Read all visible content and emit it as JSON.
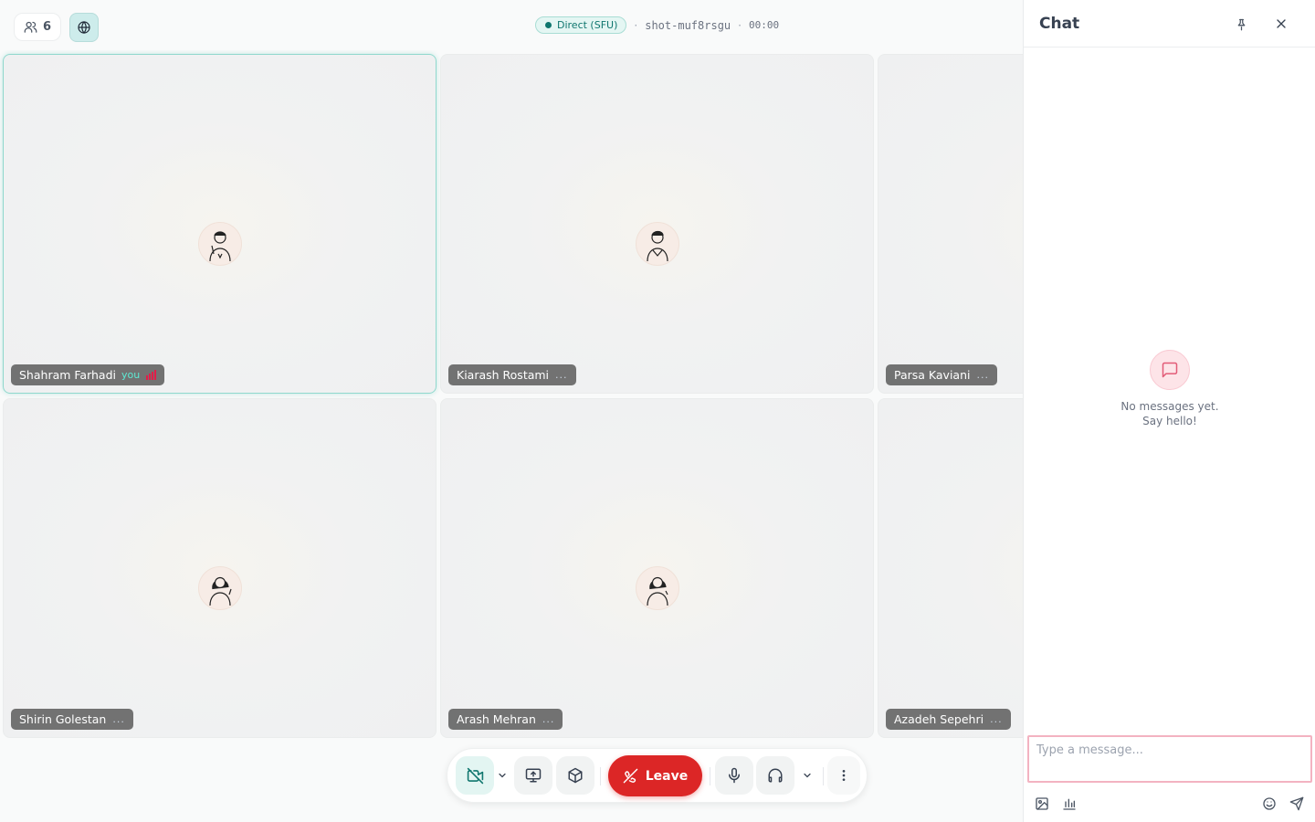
{
  "topbar": {
    "participant_count": "6",
    "connection_label": "Direct (SFU)",
    "separator": "·",
    "room_id": "shot-muf8rsgu",
    "timer": "00:00"
  },
  "tiles": [
    {
      "name": "Shahram Farhadi",
      "you_label": "you",
      "active": true
    },
    {
      "name": "Kiarash Rostami"
    },
    {
      "name": "Parsa Kaviani"
    },
    {
      "name": "Shirin Golestan"
    },
    {
      "name": "Arash Mehran"
    },
    {
      "name": "Azadeh Sepehri"
    }
  ],
  "status_dots": "...",
  "controls": {
    "leave_label": "Leave"
  },
  "chat": {
    "title": "Chat",
    "empty_line1": "No messages yet.",
    "empty_line2": "Say hello!",
    "input_placeholder": "Type a message..."
  },
  "colors": {
    "accent": "#0f766e",
    "leave": "#dc2626",
    "signal": "#e11d48"
  },
  "icons": [
    "users-icon",
    "globe-icon",
    "camera-off-icon",
    "chevron-down-icon",
    "screen-share-icon",
    "box-icon",
    "phone-off-icon",
    "mic-icon",
    "headphones-icon",
    "more-vertical-icon",
    "pin-icon",
    "close-icon",
    "message-icon",
    "image-icon",
    "poll-icon",
    "emoji-icon",
    "send-icon"
  ]
}
